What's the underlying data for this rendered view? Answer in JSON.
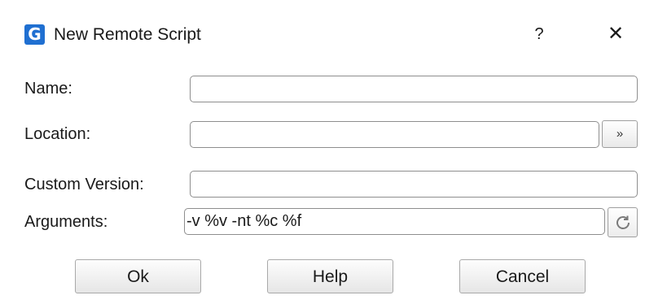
{
  "window": {
    "title": "New Remote Script",
    "app_icon": "G",
    "help_glyph": "?",
    "close_glyph": "✕"
  },
  "form": {
    "name_label": "Name:",
    "name_value": "",
    "location_label": "Location:",
    "location_value": "",
    "browse_label": "»",
    "custom_version_label": "Custom Version:",
    "custom_version_value": "",
    "arguments_label": "Arguments:",
    "arguments_value": "-v %v -nt %c %f"
  },
  "buttons": {
    "ok": "Ok",
    "help": "Help",
    "cancel": "Cancel"
  },
  "colors": {
    "accent": "#1f6fd1"
  },
  "icons": {
    "app": "app-logo-icon",
    "help": "help-icon",
    "close": "close-icon",
    "browse": "chevron-double-right-icon",
    "refresh": "refresh-icon"
  }
}
